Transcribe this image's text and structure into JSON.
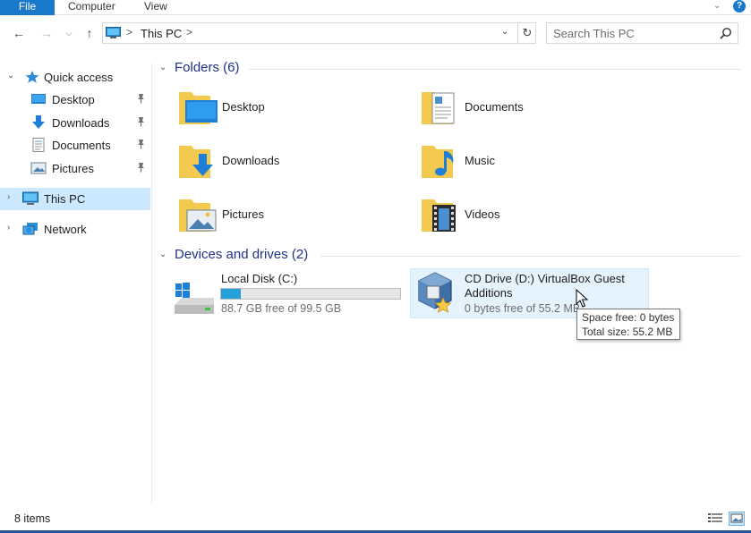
{
  "ribbon": {
    "tabs": [
      "File",
      "Computer",
      "View"
    ],
    "help": "?"
  },
  "address": {
    "crumb": "This PC",
    "separator": ">",
    "search_placeholder": "Search This PC"
  },
  "navpane": {
    "quick_access": "Quick access",
    "pinned": [
      {
        "label": "Desktop",
        "icon": "desktop-icon"
      },
      {
        "label": "Downloads",
        "icon": "downloads-icon"
      },
      {
        "label": "Documents",
        "icon": "documents-icon"
      },
      {
        "label": "Pictures",
        "icon": "pictures-icon"
      }
    ],
    "this_pc": "This PC",
    "network": "Network",
    "selected": "This PC"
  },
  "content": {
    "folders_header": "Folders (6)",
    "folders": [
      "Desktop",
      "Documents",
      "Downloads",
      "Music",
      "Pictures",
      "Videos"
    ],
    "drives_header": "Devices and drives (2)",
    "drives": [
      {
        "name": "Local Disk (C:)",
        "free_text": "88.7 GB free of 99.5 GB",
        "used_fraction": 0.109
      },
      {
        "name_line1": "CD Drive (D:) VirtualBox Guest",
        "name_line2": "Additions",
        "free_text": "0 bytes free of 55.2 MB"
      }
    ]
  },
  "tooltip": {
    "line1": "Space free: 0 bytes",
    "line2": "Total size: 55.2 MB"
  },
  "status": {
    "count": "8 items"
  },
  "colors": {
    "accent": "#1979ca",
    "selection": "#cce8ff",
    "group_header": "#1e3287",
    "capacity_bar": "#26a0da"
  }
}
